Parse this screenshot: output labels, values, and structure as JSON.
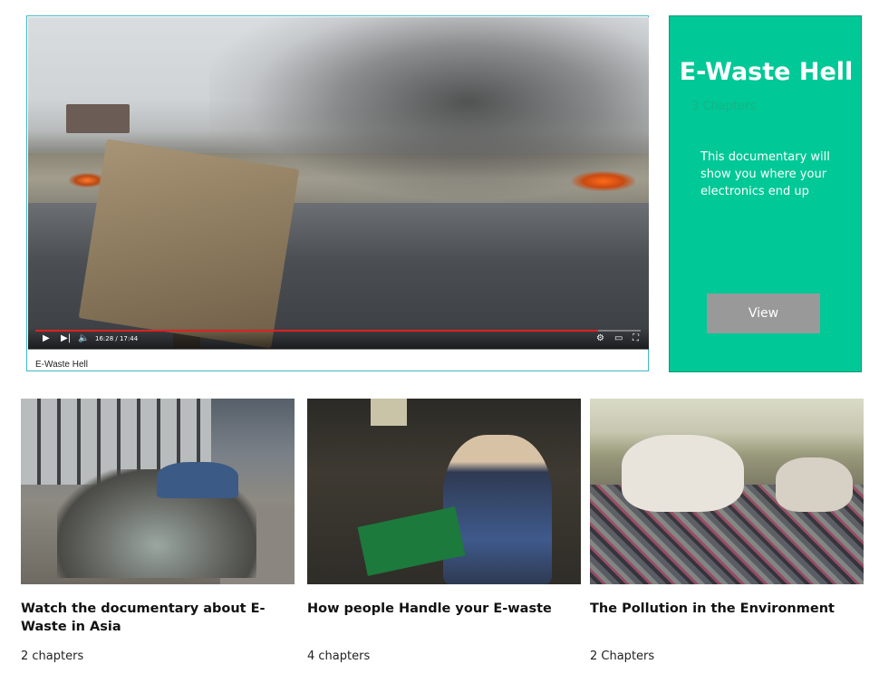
{
  "featured": {
    "video": {
      "time_readout": "16:28 / 17:44",
      "progress": 0.929,
      "caption": "E-Waste Hell",
      "controls": [
        "play-icon",
        "next-icon",
        "volume-icon",
        "settings-icon",
        "theater-icon",
        "fullscreen-icon"
      ]
    },
    "promo": {
      "title": "E-Waste Hell",
      "chapters": "3 Chapters",
      "description": "This documentary will show you where your electronics end up",
      "button_label": "View",
      "background_color": "#00c896",
      "button_color": "#999999"
    }
  },
  "cards": [
    {
      "title": "Watch the documentary about E-Waste in Asia",
      "meta": "2 chapters"
    },
    {
      "title": "How people Handle your E-waste",
      "meta": "4 chapters"
    },
    {
      "title": "The Pollution in the Environment",
      "meta": "2 Chapters"
    }
  ]
}
